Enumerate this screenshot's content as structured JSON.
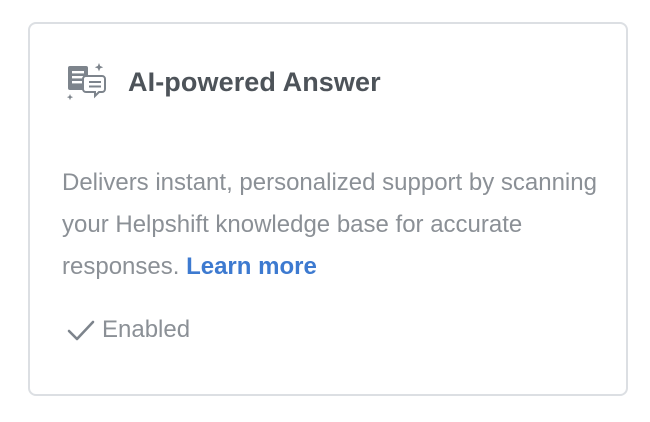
{
  "card": {
    "icon": "ai-answer-icon",
    "title": "AI-powered Answer",
    "description": "Delivers instant, personalized support by scanning your Helpshift knowledge base for accurate responses.",
    "learn_more_label": "Learn more",
    "status_icon": "checkmark-icon",
    "status_label": "Enabled"
  },
  "colors": {
    "border": "#dcdfe3",
    "title": "#4d5359",
    "body_text": "#8b9096",
    "link": "#3d7ad0",
    "icon": "#7d848c"
  }
}
